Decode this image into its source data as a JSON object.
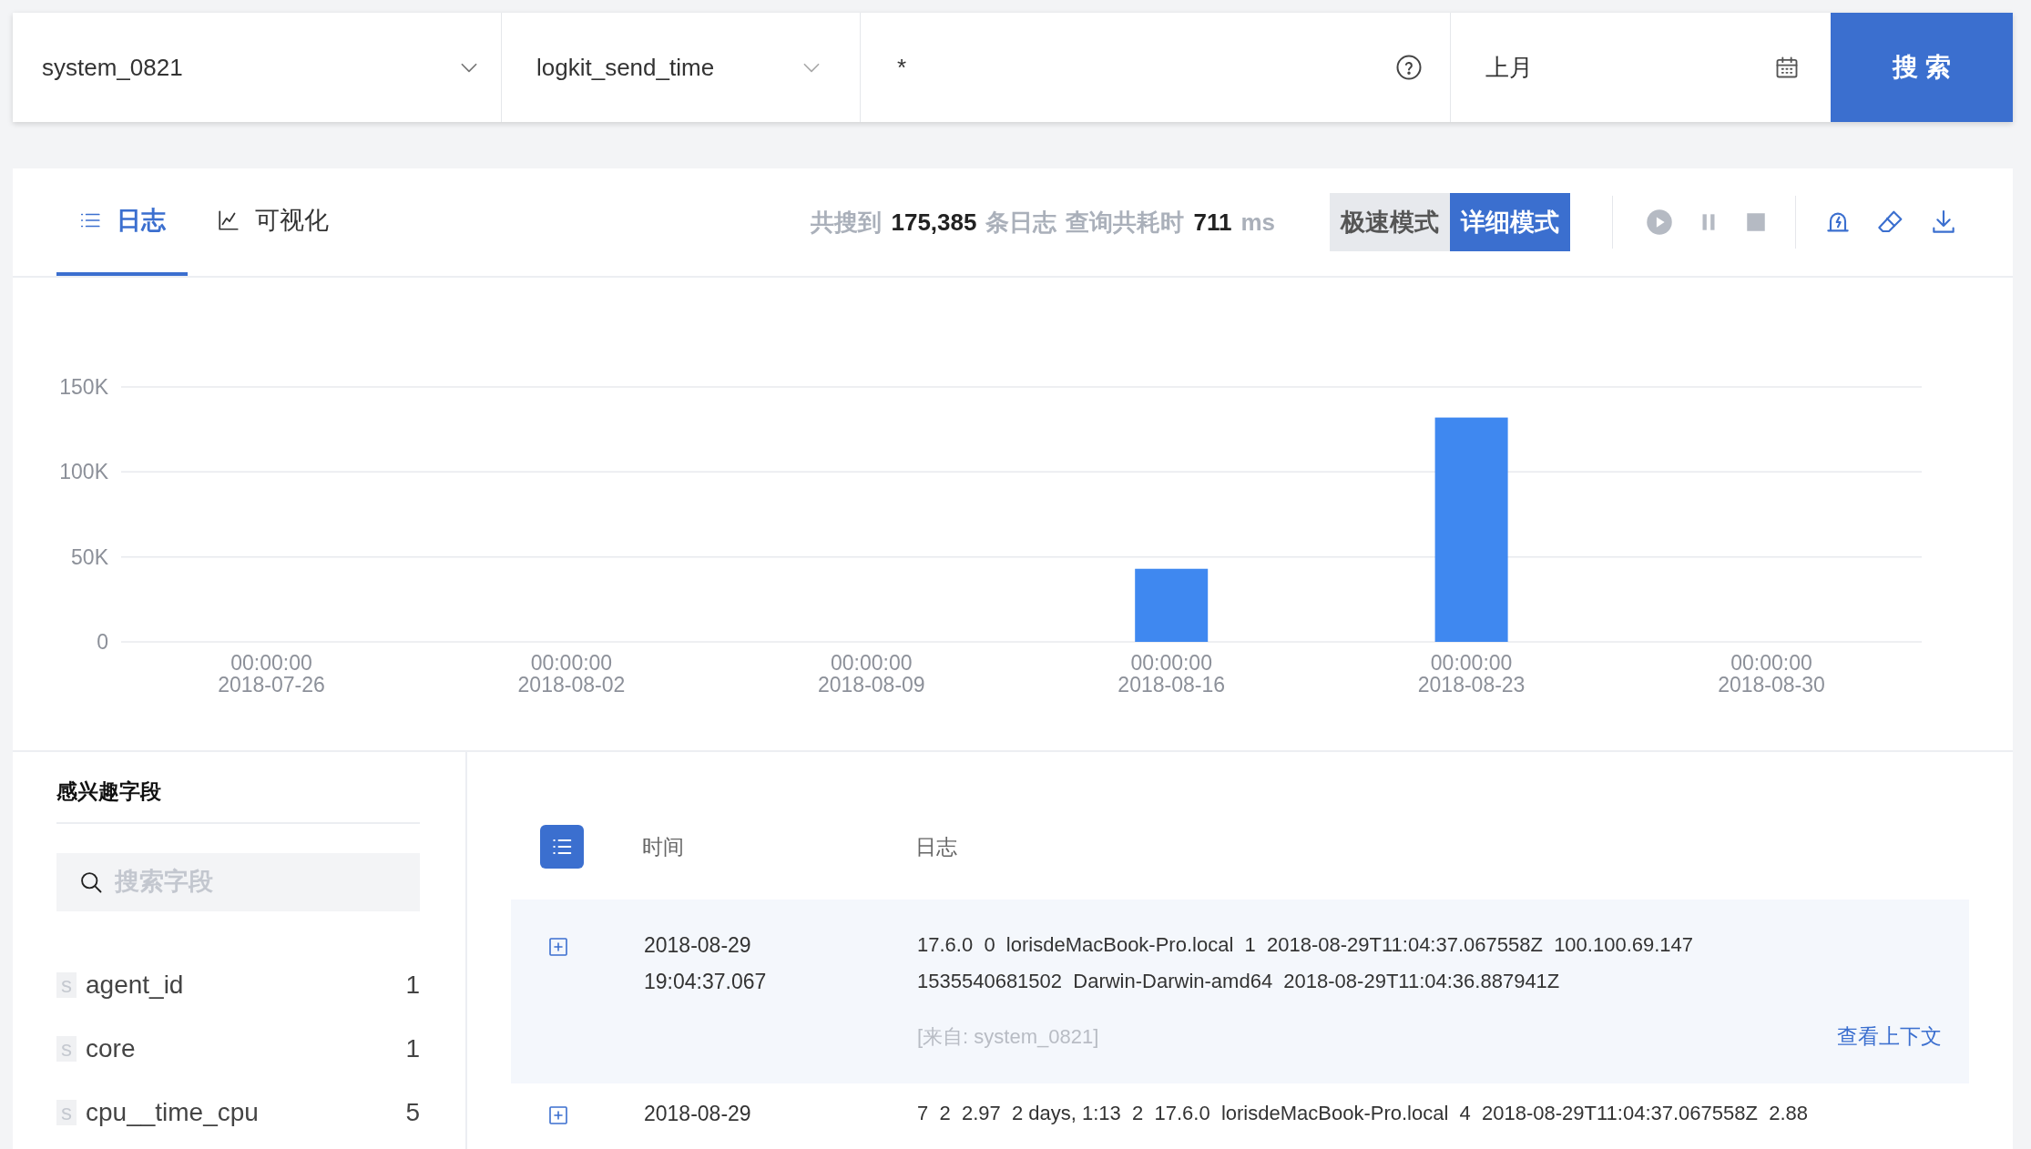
{
  "search_bar": {
    "dataset": "system_0821",
    "time_field": "logkit_send_time",
    "query": "*",
    "time_range": "上月",
    "search_button": "搜 索"
  },
  "tabs": [
    {
      "label": "日志",
      "kind": "list",
      "selected": true
    },
    {
      "label": "可视化",
      "kind": "chart",
      "selected": false
    }
  ],
  "summary": {
    "prefix": "共搜到",
    "count": "175,385",
    "count_unit": "条日志",
    "time_label": "查询共耗时",
    "time": "711",
    "time_unit": "ms"
  },
  "modes": [
    {
      "label": "极速模式",
      "selected": false
    },
    {
      "label": "详细模式",
      "selected": true
    }
  ],
  "chart": {
    "chart_data": {
      "type": "bar",
      "categories": [
        "00:00:00 2018-07-26",
        "00:00:00 2018-08-02",
        "00:00:00 2018-08-09",
        "00:00:00 2018-08-16",
        "00:00:00 2018-08-23",
        "00:00:00 2018-08-30"
      ],
      "series": [
        {
          "color": "#3f88f0",
          "values": [
            0,
            0,
            0,
            43000,
            132000,
            0
          ]
        }
      ],
      "ylim": [
        0,
        150000
      ],
      "yticks": [
        {
          "value": 0,
          "label": "0"
        },
        {
          "value": 50000,
          "label": "50K"
        },
        {
          "value": 100000,
          "label": "100K"
        },
        {
          "value": 150000,
          "label": "150K"
        }
      ]
    }
  },
  "fields_panel": {
    "title": "感兴趣字段",
    "search": {
      "placeholder": "搜索字段"
    },
    "fields": [
      {
        "type": "s",
        "name": "agent_id",
        "count": "1"
      },
      {
        "type": "s",
        "name": "core",
        "count": "1"
      },
      {
        "type": "s",
        "name": "cpu__time_cpu",
        "count": "5"
      }
    ]
  },
  "log_table": {
    "columns": [
      "时间",
      "日志"
    ],
    "rows": [
      {
        "expanded": false,
        "highlighted": true,
        "date": "2018-08-29",
        "time": "19:04:37.067",
        "log": "17.6.0  0  lorisdeMacBook-Pro.local  1  2018-08-29T11:04:37.067558Z  100.100.69.147\n1535540681502  Darwin-Darwin-amd64  2018-08-29T11:04:36.887941Z",
        "source": "[来自: system_0821]",
        "context_link": "查看上下文"
      },
      {
        "expanded": false,
        "highlighted": false,
        "date": "2018-08-29",
        "log": "7  2  2.97  2 days, 1:13  2  17.6.0  lorisdeMacBook-Pro.local  4  2018-08-29T11:04:37.067558Z  2.88"
      }
    ]
  }
}
